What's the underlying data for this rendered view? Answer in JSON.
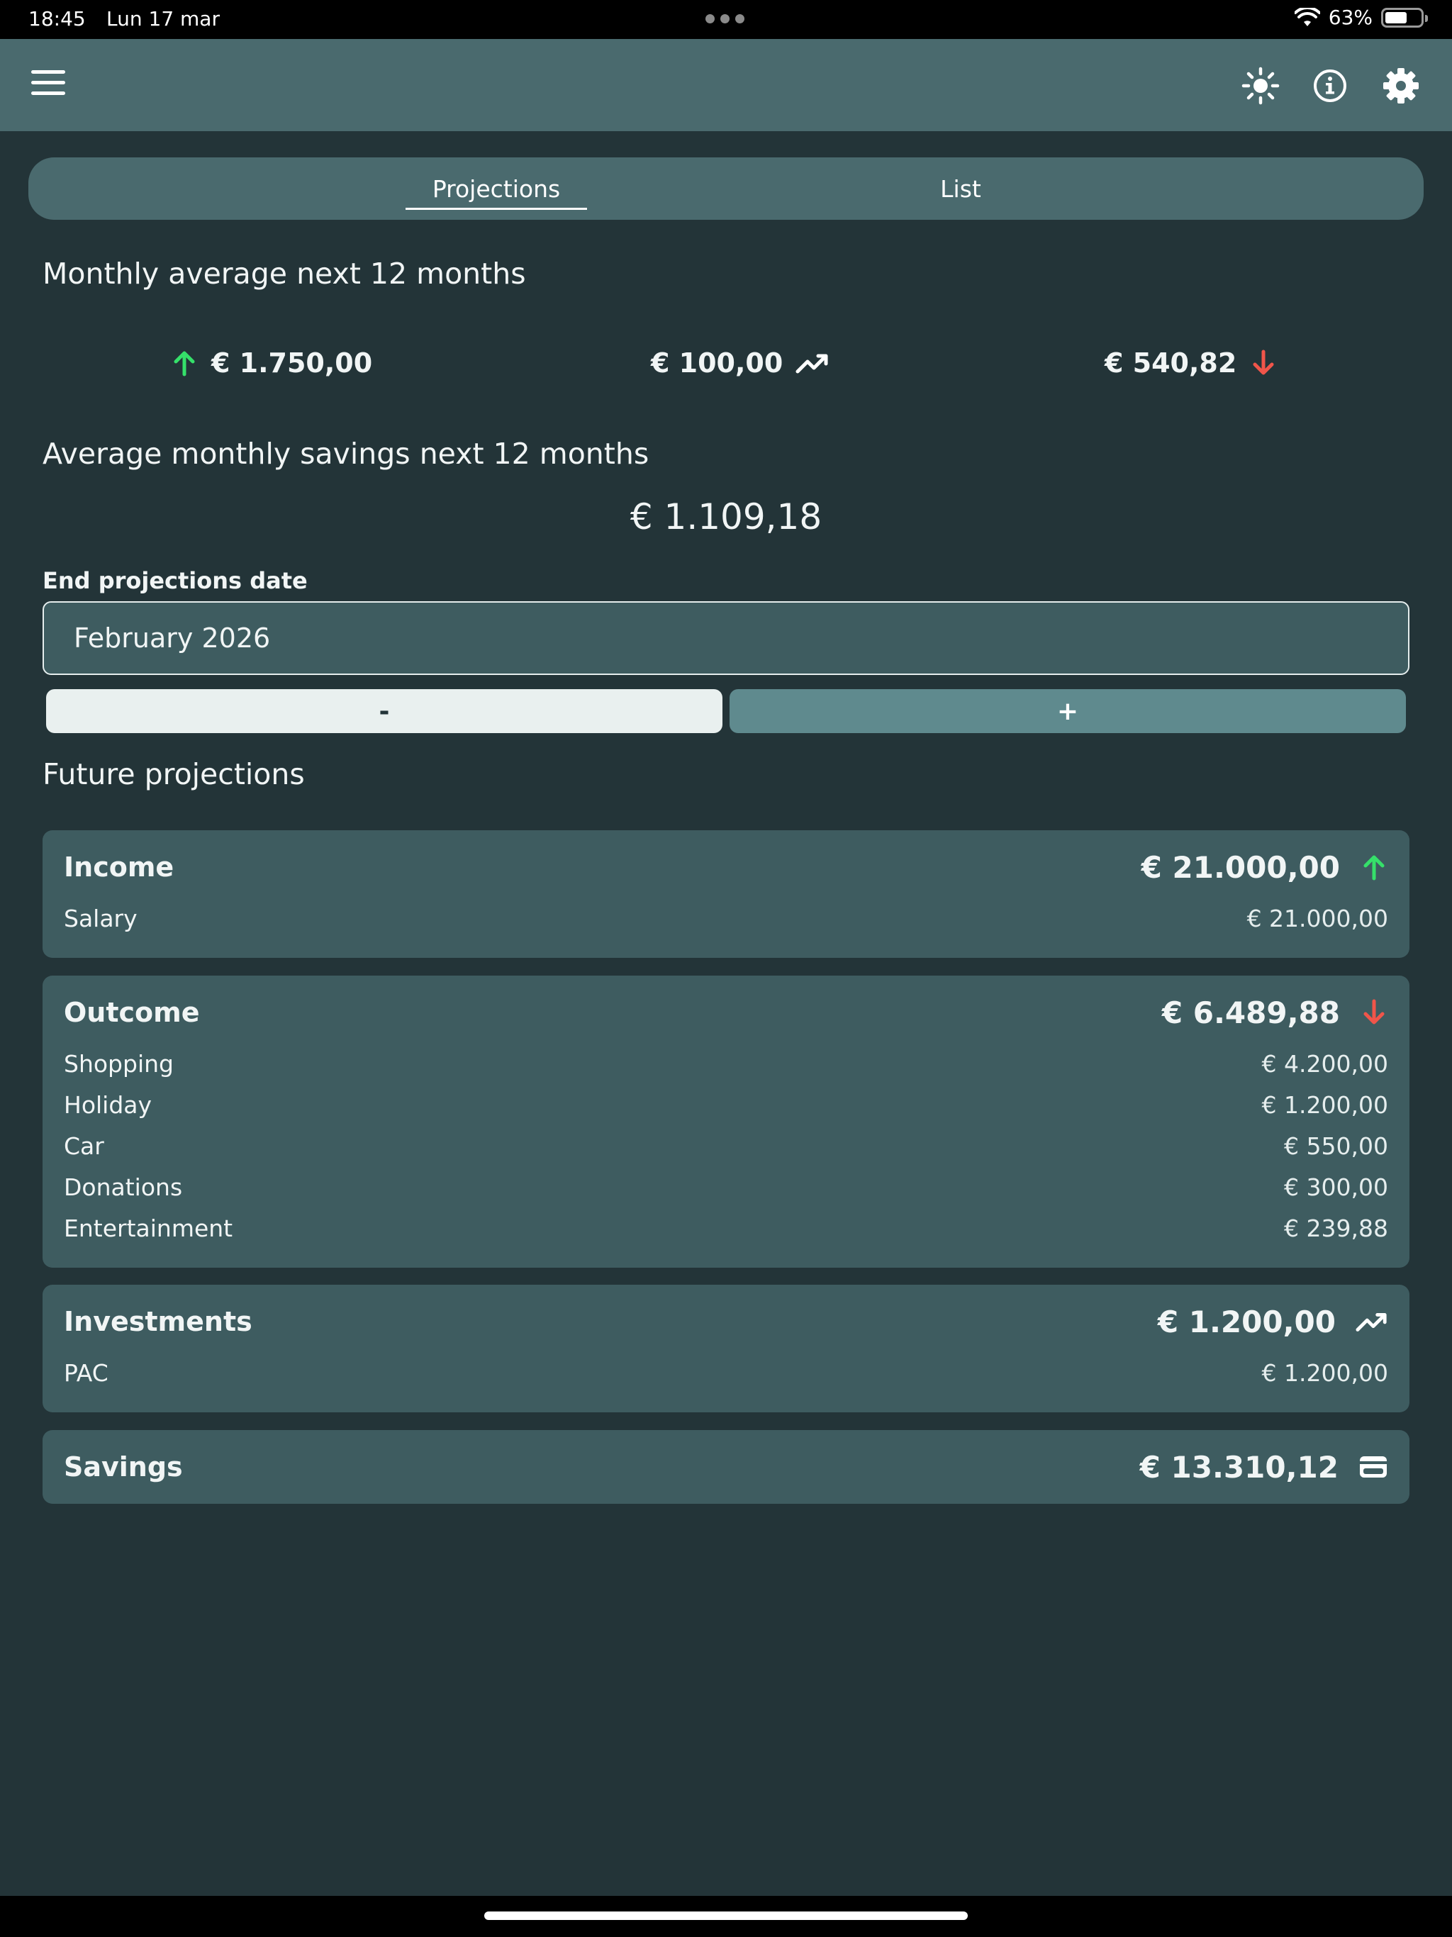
{
  "status_bar": {
    "time": "18:45",
    "date": "Lun 17 mar",
    "battery": "63%",
    "battery_level": 0.63
  },
  "tabs": [
    {
      "label": "Projections",
      "active": true
    },
    {
      "label": "List",
      "active": false
    }
  ],
  "monthly_average": {
    "title": "Monthly average next 12 months",
    "income": "€ 1.750,00",
    "investments": "€ 100,00",
    "outcome": "€ 540,82"
  },
  "average_savings": {
    "title": "Average monthly savings next 12 months",
    "value": "€ 1.109,18"
  },
  "end_date": {
    "label": "End projections date",
    "value": "February 2026",
    "minus_label": "-",
    "plus_label": "+"
  },
  "future": {
    "title": "Future projections",
    "income": {
      "title": "Income",
      "total": "€ 21.000,00",
      "items": [
        {
          "label": "Salary",
          "amount": "€ 21.000,00"
        }
      ]
    },
    "outcome": {
      "title": "Outcome",
      "total": "€ 6.489,88",
      "items": [
        {
          "label": "Shopping",
          "amount": "€ 4.200,00"
        },
        {
          "label": "Holiday",
          "amount": "€ 1.200,00"
        },
        {
          "label": "Car",
          "amount": "€ 550,00"
        },
        {
          "label": "Donations",
          "amount": "€ 300,00"
        },
        {
          "label": "Entertainment",
          "amount": "€ 239,88"
        }
      ]
    },
    "investments": {
      "title": "Investments",
      "total": "€ 1.200,00",
      "items": [
        {
          "label": "PAC",
          "amount": "€ 1.200,00"
        }
      ]
    },
    "savings": {
      "title": "Savings",
      "total": "€ 13.310,12"
    }
  },
  "colors": {
    "income": "#35e06a",
    "outcome": "#f0554a",
    "neutral": "#ffffff",
    "background": "#233438",
    "app_bar": "#4a6a6e",
    "card": "#3e5c60"
  },
  "icons": {
    "menu": "hamburger-icon",
    "theme": "sun-icon",
    "info": "info-icon",
    "settings": "gear-icon",
    "income": "arrow-up-icon",
    "outcome": "arrow-down-icon",
    "investments": "trending-up-icon",
    "savings": "wallet-icon"
  }
}
